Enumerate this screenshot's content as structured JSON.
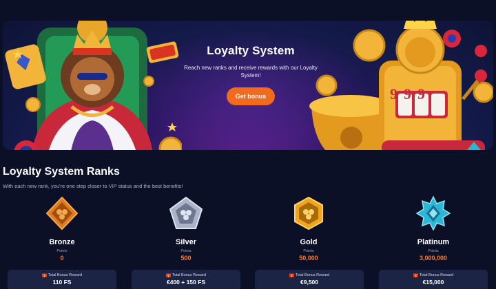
{
  "hero": {
    "title": "Loyalty System",
    "subtitle": "Reach new ranks and receive rewards with our Loyalty System!",
    "button_label": "Get bonus",
    "machine_digits": "999"
  },
  "ranks_section": {
    "title": "Loyalty System Ranks",
    "subtitle": "With each new rank, you're one step closer to VIP status and the best benefits!"
  },
  "ranks": [
    {
      "name": "Bronze",
      "points_label": "Points",
      "points": "0",
      "reward_label": "Total Bonus Reward",
      "reward_value": "110 FS",
      "badge_color": "#e07a1e",
      "badge_icon": "hexagon-diamond-icon"
    },
    {
      "name": "Silver",
      "points_label": "Points",
      "points": "500",
      "reward_label": "Total Bonus Reward",
      "reward_value": "€400 + 150 FS",
      "badge_color": "#aab4c8",
      "badge_icon": "pentagon-icon"
    },
    {
      "name": "Gold",
      "points_label": "Points",
      "points": "50,000",
      "reward_label": "Total Bonus Reward",
      "reward_value": "€9,500",
      "badge_color": "#f0a51c",
      "badge_icon": "hexagon-icon"
    },
    {
      "name": "Platinum",
      "points_label": "Points",
      "points": "3,000,000",
      "reward_label": "Total Bonus Reward",
      "reward_value": "€15,000",
      "badge_color": "#2bb6d6",
      "badge_icon": "star-gem-icon"
    }
  ],
  "colors": {
    "background": "#0b1026",
    "accent": "#f26a1b",
    "points": "#ff7a2a",
    "card": "#1c2445"
  }
}
